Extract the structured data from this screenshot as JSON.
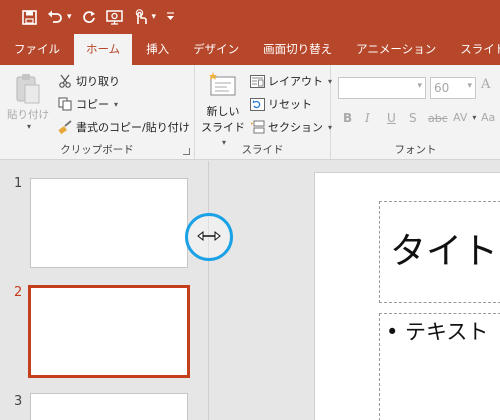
{
  "qat": {
    "icons": [
      "save-icon",
      "undo-icon",
      "redo-icon",
      "present-from-start-icon",
      "touch-mode-icon",
      "customize-qat-icon"
    ]
  },
  "tabs": [
    {
      "label": "ファイル",
      "active": false
    },
    {
      "label": "ホーム",
      "active": true
    },
    {
      "label": "挿入",
      "active": false
    },
    {
      "label": "デザイン",
      "active": false
    },
    {
      "label": "画面切り替え",
      "active": false
    },
    {
      "label": "アニメーション",
      "active": false
    },
    {
      "label": "スライド ショー",
      "active": false
    }
  ],
  "ribbon": {
    "clipboard": {
      "label": "クリップボード",
      "paste": "貼り付け",
      "cut": "切り取り",
      "copy": "コピー",
      "format_painter": "書式のコピー/貼り付け"
    },
    "slides": {
      "label": "スライド",
      "new_slide_line1": "新しい",
      "new_slide_line2": "スライド",
      "layout": "レイアウト",
      "reset": "リセット",
      "section": "セクション"
    },
    "font": {
      "label": "フォント",
      "font_name": "",
      "font_size": "60",
      "bold": "B",
      "italic": "I",
      "underline": "U",
      "shadow": "S",
      "strikethrough": "abc",
      "spacing": "AV",
      "case": "Aa"
    }
  },
  "thumbnails": [
    {
      "number": "1",
      "selected": false
    },
    {
      "number": "2",
      "selected": true
    },
    {
      "number": "3",
      "selected": false
    }
  ],
  "slide": {
    "title_placeholder": "タイトル",
    "body_placeholder": "• テキスト"
  },
  "colors": {
    "accent": "#b7472a",
    "selection": "#c43e1c",
    "cursor_ring": "#1aa1e6"
  }
}
